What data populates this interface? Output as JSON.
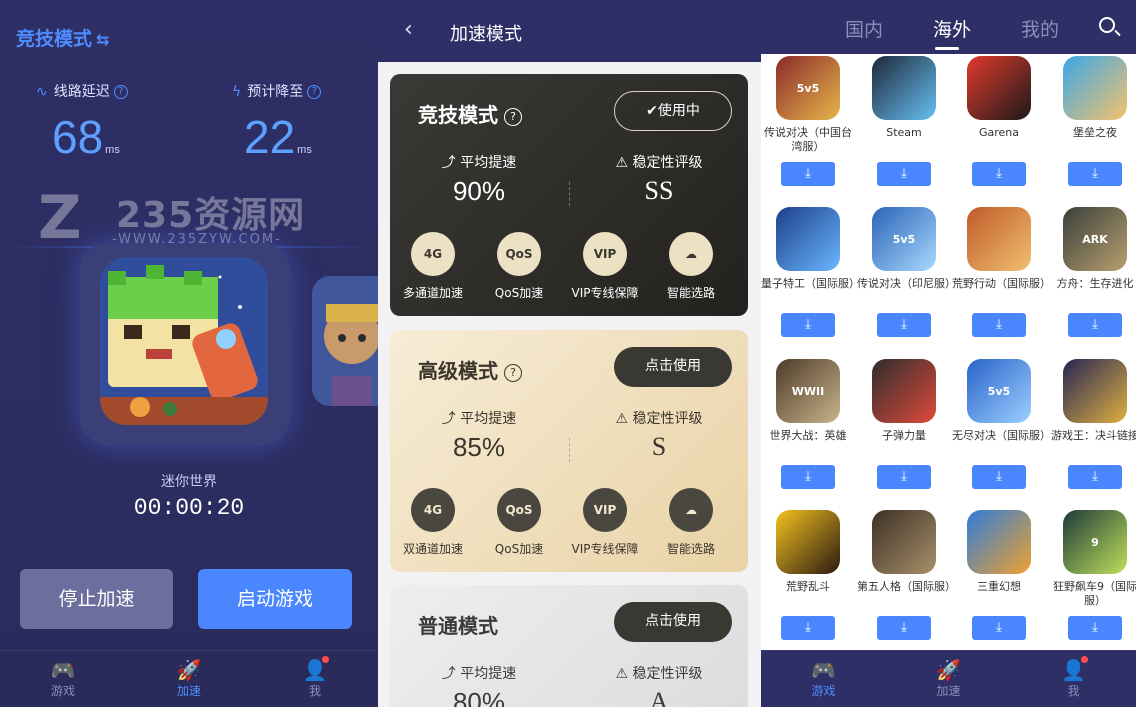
{
  "panel1": {
    "mode_title": "竞技模式",
    "latency_label": "线路延迟",
    "expected_label": "预计降至",
    "latency_value": "68",
    "expected_value": "22",
    "unit": "ms",
    "watermark_title": "235资源网",
    "watermark_sub": "-WWW.235ZYW.COM-",
    "game_name": "迷你世界",
    "timer": "00:00:20",
    "stop_button": "停止加速",
    "launch_button": "启动游戏",
    "tabs": [
      "游戏",
      "加速",
      "我"
    ],
    "active_tab": 1
  },
  "panel2": {
    "header_title": "加速模式",
    "cards": [
      {
        "title": "竞技模式",
        "button": "✔使用中",
        "speed_label": "平均提速",
        "stability_label": "稳定性评级",
        "speed_value": "90%",
        "stability_value": "SS",
        "features": [
          "多通道加速",
          "QoS加速",
          "VIP专线保障",
          "智能选路"
        ]
      },
      {
        "title": "高级模式",
        "button": "点击使用",
        "speed_label": "平均提速",
        "stability_label": "稳定性评级",
        "speed_value": "85%",
        "stability_value": "S",
        "features": [
          "双通道加速",
          "QoS加速",
          "VIP专线保障",
          "智能选路"
        ]
      },
      {
        "title": "普通模式",
        "button": "点击使用",
        "speed_label": "平均提速",
        "stability_label": "稳定性评级",
        "speed_value": "80%",
        "stability_value": "A"
      }
    ]
  },
  "panel3": {
    "tabs": [
      "国内",
      "海外",
      "我的"
    ],
    "active_tab": 1,
    "games": [
      {
        "name": "传说对决（中国台湾服）"
      },
      {
        "name": "Steam"
      },
      {
        "name": "Garena"
      },
      {
        "name": "堡垒之夜"
      },
      {
        "name": "量子特工（国际服）"
      },
      {
        "name": "传说对决（印尼服）"
      },
      {
        "name": "荒野行动（国际服）"
      },
      {
        "name": "方舟：生存进化"
      },
      {
        "name": "世界大战：英雄"
      },
      {
        "name": "子弹力量"
      },
      {
        "name": "无尽对决（国际服）"
      },
      {
        "name": "游戏王：决斗链接"
      },
      {
        "name": "荒野乱斗"
      },
      {
        "name": "第五人格（国际服）"
      },
      {
        "name": "三重幻想"
      },
      {
        "name": "狂野飙车9（国际服）"
      }
    ],
    "bottom_tabs": [
      "游戏",
      "加速",
      "我"
    ],
    "active_bottom_tab": 0
  },
  "colors": {
    "accent": "#4a87ff",
    "header_bg": "#2e2f66",
    "stop_button": "#6c6f9e"
  }
}
